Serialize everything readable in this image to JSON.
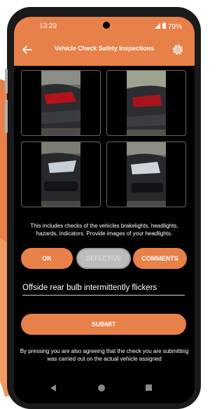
{
  "status_bar": {
    "time": "13:29",
    "battery": "79%"
  },
  "app_bar": {
    "title": "Vehicle Check Safety Inspections",
    "back_icon": "arrow-left-icon",
    "settings_icon": "gear-icon"
  },
  "accent_color": "#e8804a",
  "description": "This includes checks of the vehicles brakelights, headlights, hazards, indicators. Provide images of your headlights.",
  "buttons": {
    "ok": "OK",
    "defective": "DEFECTIVE",
    "comments": "COMMENTS",
    "submit": "SUBMIT"
  },
  "comment_field": {
    "value": "Offside rear bulb intermittently flickers"
  },
  "agreement_note": "By pressing you are also agreeing that the check you are submitting was carried out on the actual vehicle assigned"
}
